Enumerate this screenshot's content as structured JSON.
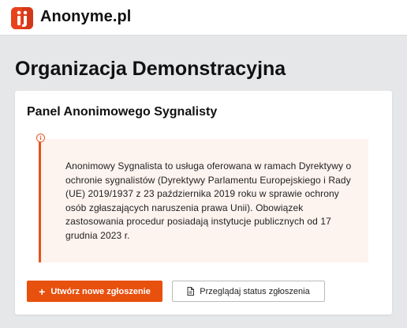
{
  "header": {
    "brand": "Anonyme.pl",
    "logo_icon": "logo-ij-mark",
    "accent_color": "#e8431c"
  },
  "page": {
    "organization_title": "Organizacja Demonstracyjna"
  },
  "panel": {
    "title": "Panel Anonimowego Sygnalisty",
    "info_icon": "info-icon",
    "info_text": "Anonimowy Sygnalista to usługa oferowana w ramach Dyrektywy o ochronie sygnalistów (Dyrektywy Parlamentu Europejskiego i Rady (UE) 2019/1937 z 23 października 2019 roku w sprawie ochrony osób zgłaszających naruszenia prawa Unii). Obowiązek zastosowania procedur posiadają instytucje publicznych od 17 grudnia 2023 r.",
    "info_accent_color": "#e8521c",
    "info_background": "#fdf3ef"
  },
  "actions": {
    "create_report_label": "Utwórz nowe zgłoszenie",
    "create_report_icon": "plus-icon",
    "browse_status_label": "Przeglądaj status zgłoszenia",
    "browse_status_icon": "document-icon"
  }
}
